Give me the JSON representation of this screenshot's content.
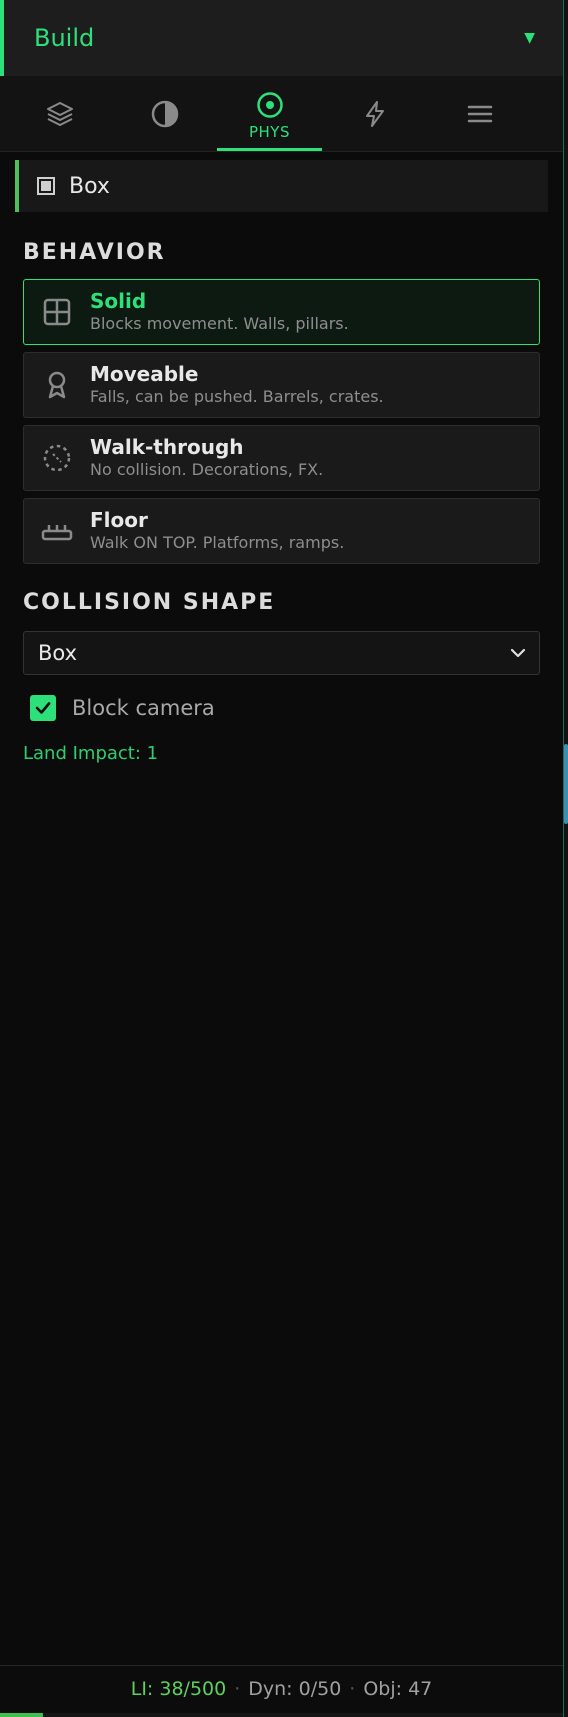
{
  "header": {
    "title": "Build",
    "caret": "▼"
  },
  "tabs": [
    {
      "icon": "layers-icon",
      "label": ""
    },
    {
      "icon": "contrast-icon",
      "label": ""
    },
    {
      "icon": "target-icon",
      "label": "PHYS",
      "active": true
    },
    {
      "icon": "lightning-icon",
      "label": ""
    },
    {
      "icon": "menu-icon",
      "label": ""
    }
  ],
  "selected_object": {
    "icon": "box-icon",
    "name": "Box"
  },
  "behavior": {
    "title": "BEHAVIOR",
    "options": [
      {
        "icon": "grid-icon",
        "title": "Solid",
        "desc": "Blocks movement. Walls, pillars.",
        "selected": true
      },
      {
        "icon": "weight-icon",
        "title": "Moveable",
        "desc": "Falls, can be pushed. Barrels, crates.",
        "selected": false
      },
      {
        "icon": "dashed-circle-icon",
        "title": "Walk-through",
        "desc": "No collision. Decorations, FX.",
        "selected": false
      },
      {
        "icon": "platform-icon",
        "title": "Floor",
        "desc": "Walk ON TOP. Platforms, ramps.",
        "selected": false
      }
    ]
  },
  "collision": {
    "title": "COLLISION SHAPE",
    "selected": "Box"
  },
  "block_camera": {
    "label": "Block camera",
    "checked": true
  },
  "land_impact": "Land Impact: 1",
  "footer": {
    "li": "LI: 38/500",
    "sep": "·",
    "dyn": "Dyn: 0/50",
    "obj": "Obj: 47",
    "li_fraction": 0.076
  },
  "colors": {
    "accent": "#2ee07a",
    "footer_bar": "#3fbf4f"
  }
}
